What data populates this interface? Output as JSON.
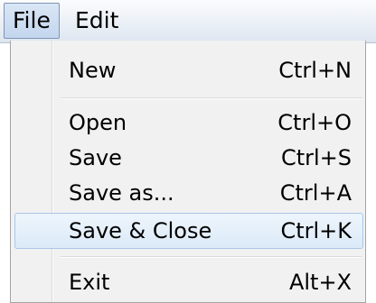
{
  "menubar": {
    "items": [
      {
        "label": "File",
        "active": true
      },
      {
        "label": "Edit",
        "active": false
      }
    ]
  },
  "file_menu": {
    "items": [
      {
        "label": "New",
        "shortcut": "Ctrl+N"
      },
      {
        "label": "Open",
        "shortcut": "Ctrl+O"
      },
      {
        "label": "Save",
        "shortcut": "Ctrl+S"
      },
      {
        "label": "Save as...",
        "shortcut": "Ctrl+A"
      },
      {
        "label": "Save & Close",
        "shortcut": "Ctrl+K",
        "highlighted": true
      },
      {
        "label": "Exit",
        "shortcut": "Alt+X"
      }
    ]
  },
  "colors": {
    "highlight_border": "#a9c8e8",
    "highlight_fill": "#dbeaf8",
    "menu_background": "#f1f1f1"
  }
}
